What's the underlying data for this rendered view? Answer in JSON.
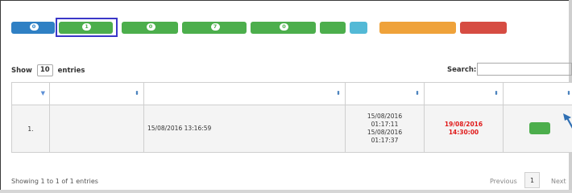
{
  "nav": {
    "home": {
      "label": "",
      "badge": "0"
    },
    "in_progress": {
      "label": "",
      "badge": "1"
    },
    "requested_fix": {
      "label": "",
      "badge": "0"
    },
    "completed": {
      "label": "",
      "badge": "7"
    },
    "checked": {
      "label": "",
      "badge": "0"
    },
    "report": {
      "label": ""
    },
    "manual": {
      "label": ""
    },
    "user": {
      "label": ""
    },
    "logout": {
      "label": ""
    }
  },
  "status_title": "",
  "length_menu": {
    "show_label": "Show",
    "value": "10",
    "entries_label": "entries"
  },
  "search": {
    "label": "Search:",
    "value": ""
  },
  "table": {
    "columns": [
      "",
      "",
      "",
      "",
      "",
      ""
    ],
    "rows": [
      {
        "index": "1.",
        "type_line1": "",
        "type_line2": "",
        "detail_line1": "",
        "detail_line2": "",
        "detail_line3": "15/08/2016 13:16:59",
        "assign_line1": "15/08/2016",
        "assign_line2": "01:17:11",
        "assign_line3": "",
        "assign_line4": "15/08/2016",
        "assign_line5": "01:17:37",
        "due_line1": "19/08/2016",
        "due_line2": "14:30:00",
        "action_label": ""
      }
    ]
  },
  "footer": {
    "info": "Showing 1 to 1 of 1 entries",
    "previous": "Previous",
    "page": "1",
    "next": "Next"
  },
  "colors": {
    "primary": "#2f80c4",
    "success": "#4cae4c",
    "info": "#53b9d6",
    "warning": "#efa23a",
    "danger": "#d64c42",
    "due": "#e01919",
    "selection_outline": "#3a37c8",
    "arrow": "#2f6fb3"
  }
}
